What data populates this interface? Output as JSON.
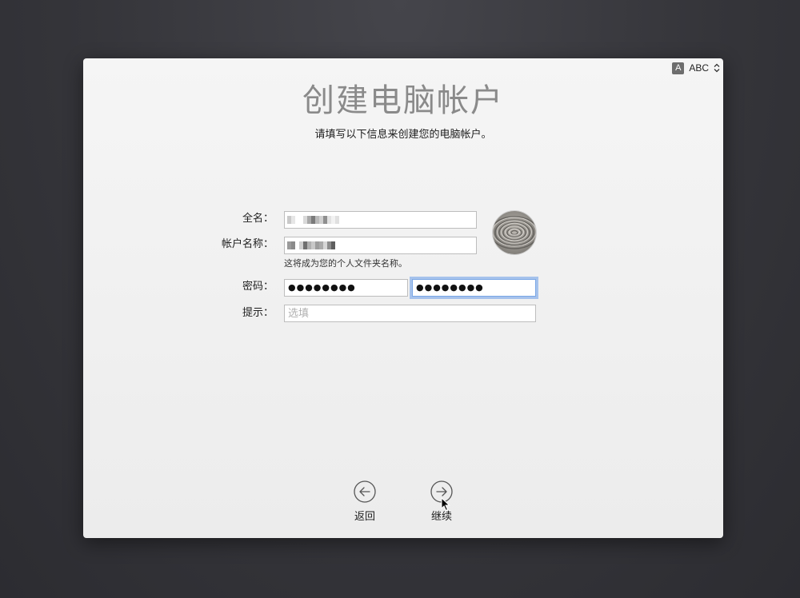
{
  "input_menu": {
    "icon_letter": "A",
    "source": "ABC"
  },
  "title": "创建电脑帐户",
  "subtitle": "请填写以下信息来创建您的电脑帐户。",
  "form": {
    "full_name_label": "全名：",
    "account_name_label": "帐户名称：",
    "account_name_hint": "这将成为您的个人文件夹名称。",
    "password_label": "密码：",
    "password_value": "●●●●●●●●",
    "verify_value": "●●●●●●●●",
    "hint_label": "提示：",
    "hint_placeholder": "选填"
  },
  "nav": {
    "back_label": "返回",
    "continue_label": "继续"
  },
  "colors": {
    "focus_ring": "#679ce8",
    "title": "#8a8a8a"
  }
}
